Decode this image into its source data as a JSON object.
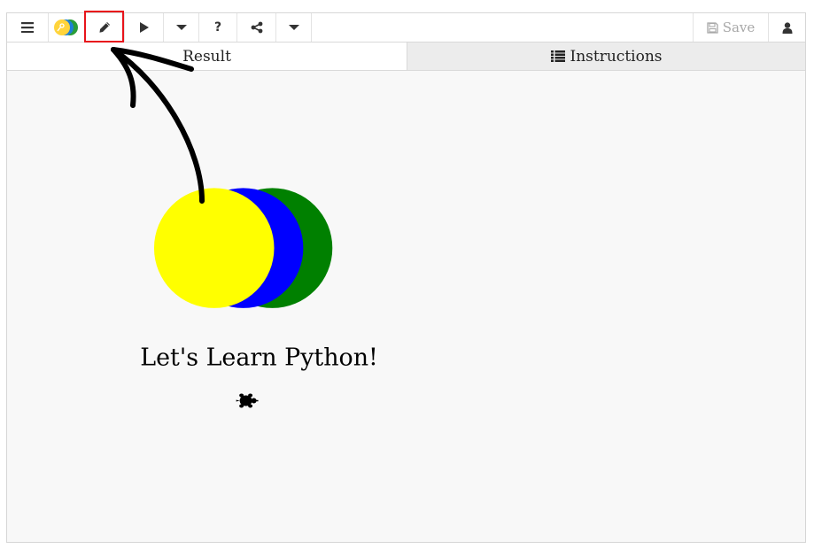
{
  "toolbar": {
    "save_label": "Save"
  },
  "tabs": {
    "result_label": "Result",
    "instructions_label": "Instructions"
  },
  "canvas": {
    "text": "Let's Learn Python!",
    "circle_colors": [
      "#008000",
      "#0000ff",
      "#ffff00"
    ]
  },
  "colors": {
    "highlight": "#e8141b",
    "arrow": "#000000"
  }
}
